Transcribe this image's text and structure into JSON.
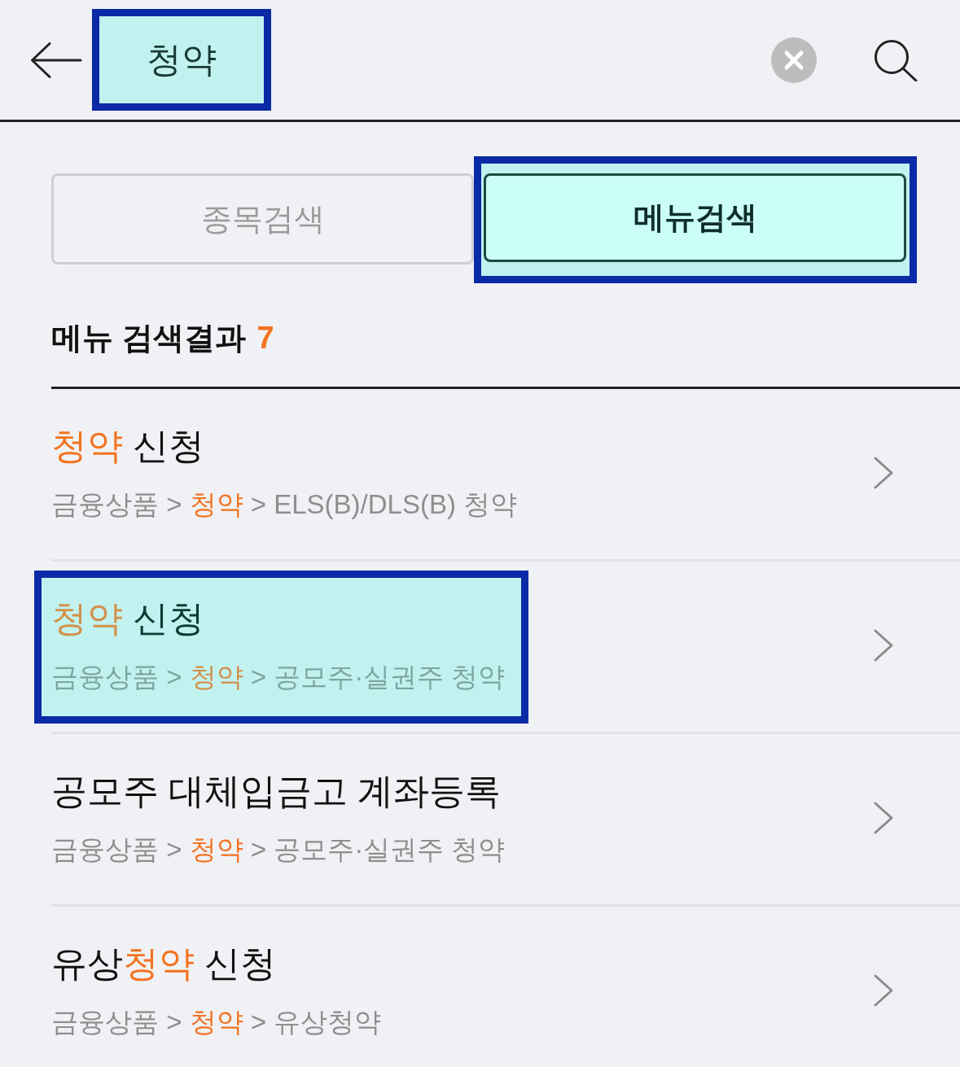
{
  "search": {
    "value": "청약",
    "highlighted": true
  },
  "tabs": [
    {
      "label": "종목검색",
      "selected": false,
      "highlighted": false
    },
    {
      "label": "메뉴검색",
      "selected": true,
      "highlighted": true
    }
  ],
  "results": {
    "heading": "메뉴 검색결과",
    "count": "7",
    "items": [
      {
        "title": [
          {
            "text": "청약",
            "match": true
          },
          {
            "text": " 신청",
            "match": false
          }
        ],
        "path": [
          {
            "text": "금융상품 > ",
            "match": false
          },
          {
            "text": "청약",
            "match": true
          },
          {
            "text": " > ELS(B)/DLS(B) 청약",
            "match": false
          }
        ],
        "highlighted": false
      },
      {
        "title": [
          {
            "text": "청약",
            "match": true
          },
          {
            "text": " 신청",
            "match": false
          }
        ],
        "path": [
          {
            "text": "금융상품 > ",
            "match": false
          },
          {
            "text": "청약",
            "match": true
          },
          {
            "text": " > 공모주·실권주 청약",
            "match": false
          }
        ],
        "highlighted": true
      },
      {
        "title": [
          {
            "text": "공모주 대체입금고 계좌등록",
            "match": false
          }
        ],
        "path": [
          {
            "text": "금융상품 > ",
            "match": false
          },
          {
            "text": "청약",
            "match": true
          },
          {
            "text": " > 공모주·실권주 청약",
            "match": false
          }
        ],
        "highlighted": false
      },
      {
        "title": [
          {
            "text": "유상",
            "match": false
          },
          {
            "text": "청약",
            "match": true
          },
          {
            "text": " 신청",
            "match": false
          }
        ],
        "path": [
          {
            "text": "금융상품 > ",
            "match": false
          },
          {
            "text": "청약",
            "match": true
          },
          {
            "text": " > 유상청약",
            "match": false
          }
        ],
        "highlighted": false
      }
    ]
  }
}
